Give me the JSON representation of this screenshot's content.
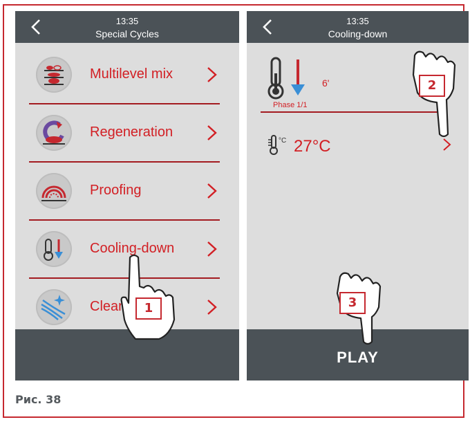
{
  "left_screen": {
    "status": {
      "time": "13:35",
      "title": "Special Cycles"
    },
    "items": [
      {
        "label": "Multilevel mix",
        "icon": "multilevel-mix-icon"
      },
      {
        "label": "Regeneration",
        "icon": "regeneration-icon"
      },
      {
        "label": "Proofing",
        "icon": "proofing-icon"
      },
      {
        "label": "Cooling-down",
        "icon": "cooling-down-icon"
      },
      {
        "label": "Cleaning",
        "icon": "cleaning-icon"
      }
    ]
  },
  "right_screen": {
    "status": {
      "time": "13:35",
      "title": "Cooling-down"
    },
    "phase_time": "6'",
    "phase_label": "Phase 1/1",
    "temperature": "27°C",
    "temp_unit_icon": "°C",
    "play_label": "PLAY"
  },
  "callouts": [
    "1",
    "2",
    "3"
  ],
  "caption": "Рис. 38",
  "colors": {
    "accent": "#d21f24",
    "bar": "#4b5257",
    "screen_bg": "#dddddd",
    "ice_blue": "#3a8fd6"
  }
}
